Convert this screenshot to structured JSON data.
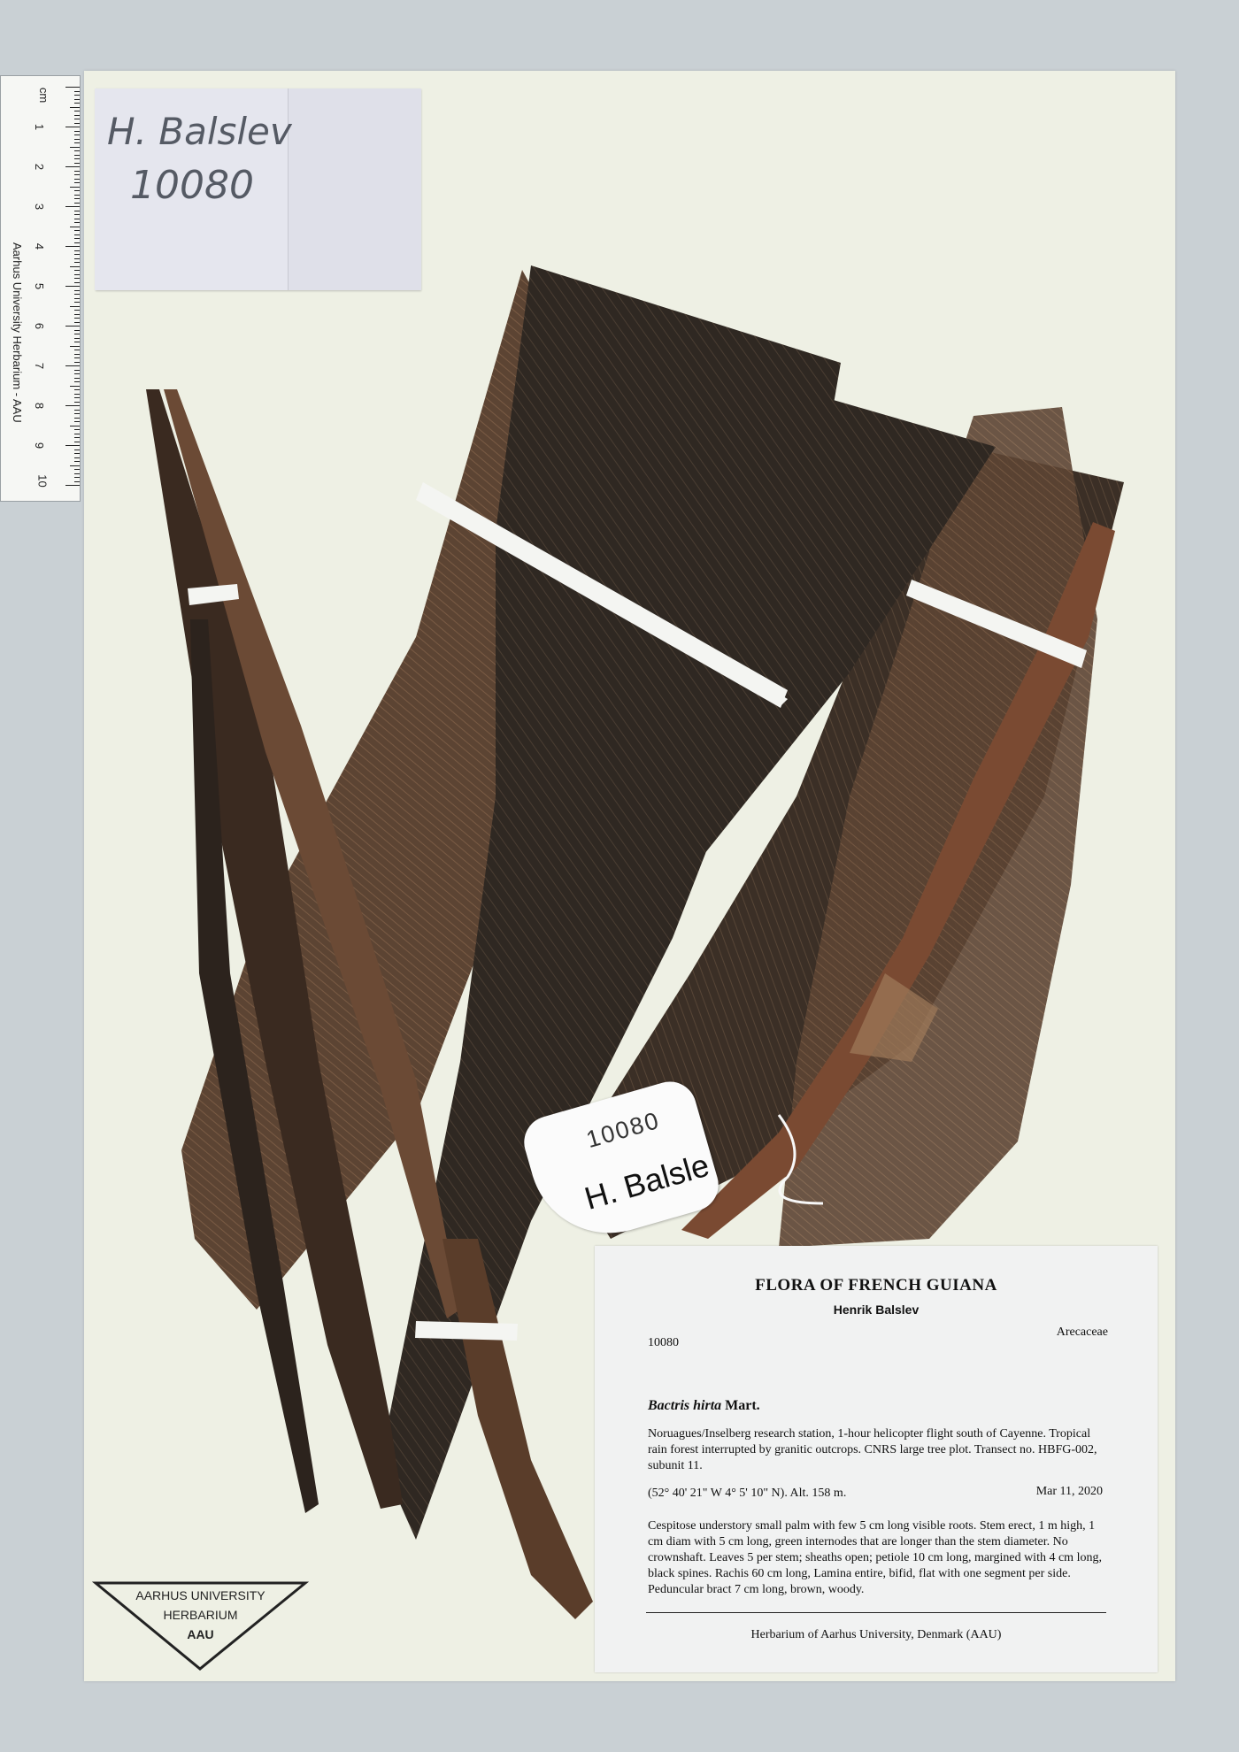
{
  "ruler": {
    "unit": "cm",
    "numbers": [
      "1",
      "2",
      "3",
      "4",
      "5",
      "6",
      "7",
      "8",
      "9",
      "10"
    ],
    "caption": "Aarhus University Herbarium - AAU"
  },
  "collector_tag": {
    "name": "H. Balslev",
    "number": "10080"
  },
  "paper_tag": {
    "number": "10080",
    "name": "H. Balsle"
  },
  "label": {
    "title": "FLORA OF FRENCH GUIANA",
    "collector": "Henrik Balslev",
    "number": "10080",
    "family": "Arecaceae",
    "taxon_genus_species": "Bactris hirta",
    "taxon_author": "Mart.",
    "locality": "Noruagues/Inselberg research station, 1-hour helicopter flight south of Cayenne. Tropical rain forest interrupted by granitic outcrops. CNRS large tree plot. Transect no. HBFG-002, subunit 11.",
    "coordinates": "(52° 40' 21\" W 4° 5' 10\" N). Alt. 158 m.",
    "date": "Mar 11, 2020",
    "description": "Cespitose understory small palm with few 5 cm long visible roots. Stem erect, 1 m high, 1 cm diam with 5 cm long, green internodes that are longer than the stem diameter. No crownshaft. Leaves 5 per stem; sheaths open; petiole 10 cm long, margined with 4 cm long, black spines. Rachis 60 cm long, Lamina entire, bifid, flat with one segment per side. Peduncular bract 7 cm long, brown, woody.",
    "footer": "Herbarium of Aarhus University, Denmark (AAU)"
  },
  "stamp": {
    "line1": "AARHUS UNIVERSITY",
    "line2": "HERBARIUM",
    "line3": "AAU"
  },
  "colors": {
    "sheet": "#eef0e4",
    "leaf_dark": "#2b2520",
    "leaf_brown": "#5a4230",
    "strap": "#f4f5f2"
  }
}
